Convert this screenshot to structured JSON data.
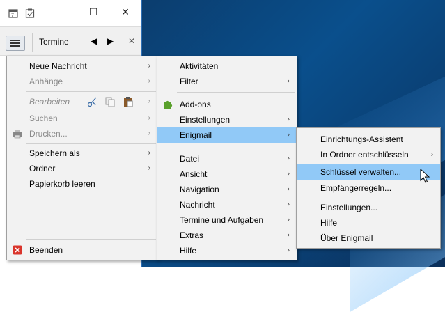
{
  "window": {
    "calendar_icon": "calendar-icon",
    "tasks_icon": "tasks-icon",
    "minimize": "—",
    "maximize": "☐",
    "close": "✕",
    "tab_label": "Termine",
    "prev": "◀",
    "next": "▶",
    "tab_close": "✕"
  },
  "main_menu": {
    "items": [
      {
        "label": "Neue Nachricht",
        "submenu": true
      },
      {
        "label": "Anhänge",
        "submenu": true,
        "disabled": true
      },
      {
        "label": "Bearbeiten",
        "submenu": true,
        "disabled": true
      },
      {
        "label": "Suchen",
        "submenu": true,
        "disabled": true
      },
      {
        "label": "Drucken...",
        "submenu": true,
        "disabled": true
      },
      {
        "label": "Speichern als",
        "submenu": true
      },
      {
        "label": "Ordner",
        "submenu": true
      },
      {
        "label": "Papierkorb leeren"
      },
      {
        "label": "Beenden"
      }
    ]
  },
  "tools_menu": {
    "items": [
      {
        "label": "Aktivitäten"
      },
      {
        "label": "Filter",
        "submenu": true
      },
      {
        "label": "Add-ons"
      },
      {
        "label": "Einstellungen",
        "submenu": true
      },
      {
        "label": "Enigmail",
        "submenu": true,
        "selected": true
      },
      {
        "label": "Datei",
        "submenu": true
      },
      {
        "label": "Ansicht",
        "submenu": true
      },
      {
        "label": "Navigation",
        "submenu": true
      },
      {
        "label": "Nachricht",
        "submenu": true
      },
      {
        "label": "Termine und Aufgaben",
        "submenu": true
      },
      {
        "label": "Extras",
        "submenu": true
      },
      {
        "label": "Hilfe",
        "submenu": true
      }
    ]
  },
  "enigmail_menu": {
    "items": [
      {
        "label": "Einrichtungs-Assistent"
      },
      {
        "label": "In Ordner entschlüsseln",
        "submenu": true
      },
      {
        "label": "Schlüssel verwalten...",
        "selected": true
      },
      {
        "label": "Empfängerregeln..."
      },
      {
        "label": "Einstellungen..."
      },
      {
        "label": "Hilfe"
      },
      {
        "label": "Über Enigmail"
      }
    ]
  },
  "arrow": "›"
}
